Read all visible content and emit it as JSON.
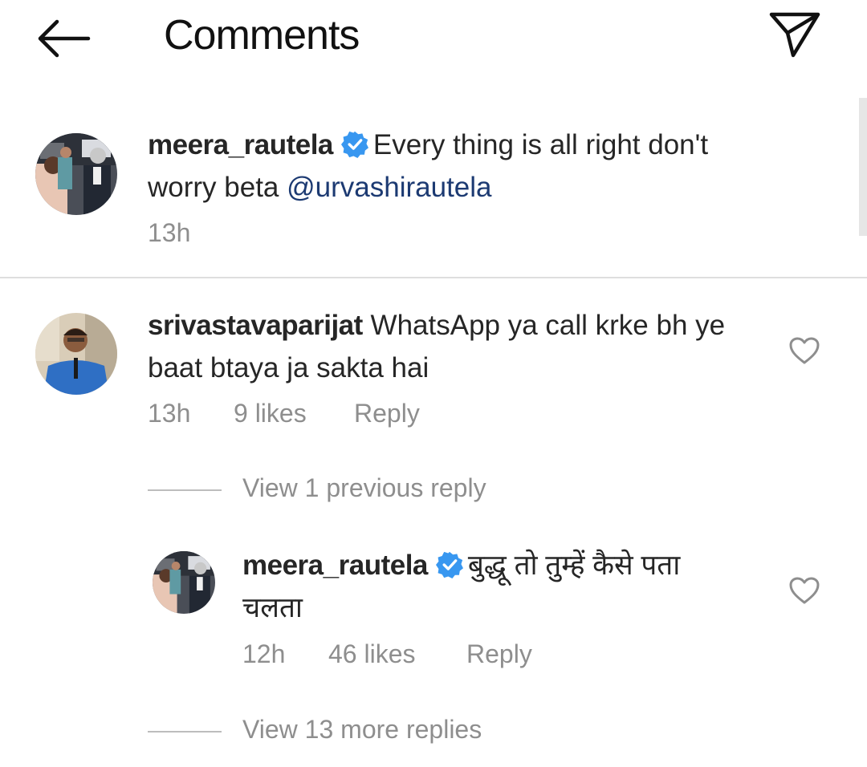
{
  "header": {
    "title": "Comments",
    "back_icon": "arrow-left-icon",
    "share_icon": "paper-plane-icon"
  },
  "caption": {
    "username": "meera_rautela",
    "verified": true,
    "text_line1": "Every thing is all right don't",
    "text_line2": "worry beta ",
    "mention": "@urvashirautela",
    "time": "13h"
  },
  "comments": [
    {
      "username": "srivastavaparijat",
      "text_line1": "WhatsApp ya call krke bh ye",
      "text_line2": "baat btaya ja sakta hai",
      "time": "13h",
      "likes": "9 likes",
      "reply_label": "Reply",
      "view_replies": "View 1 previous reply",
      "replies": [
        {
          "username": "meera_rautela",
          "verified": true,
          "text_line1": "बुद्धू तो तुम्हें कैसे पता",
          "text_line2": "चलता",
          "time": "12h",
          "likes": "46 likes",
          "reply_label": "Reply"
        }
      ],
      "more_replies": "View 13 more replies"
    }
  ],
  "colors": {
    "text": "#262626",
    "meta": "#8e8e8e",
    "verified_badge": "#3897f0",
    "mention": "#1c3a72",
    "divider": "#dedede"
  }
}
